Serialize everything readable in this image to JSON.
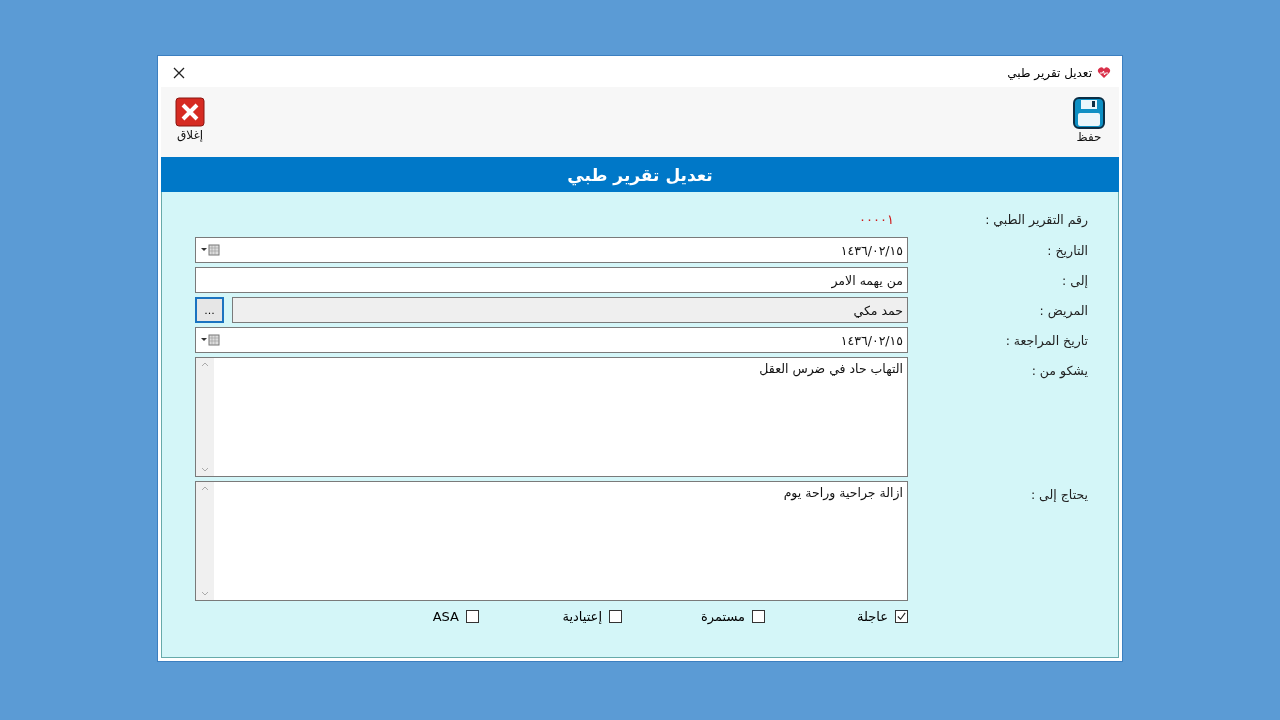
{
  "window": {
    "title": "تعديل تقرير طبي"
  },
  "toolbar": [
    {
      "kind": "save",
      "label": "حفظ"
    },
    {
      "kind": "close",
      "label": "إغلاق"
    }
  ],
  "banner": "تعديل تقرير طبي",
  "fields": [
    {
      "kind": "readout",
      "label": "رقم التقرير الطبي :",
      "value": "٠٠٠٠١"
    },
    {
      "kind": "date",
      "label": "التاريخ :",
      "value": "١٤٣٦/٠٢/١٥"
    },
    {
      "kind": "text",
      "label": "إلى :",
      "value": "من يهمه الامر"
    },
    {
      "kind": "lookup",
      "label": "المريض :",
      "value": "حمد مكي",
      "button": "..."
    },
    {
      "kind": "date",
      "label": "تاريخ المراجعة :",
      "value": "١٤٣٦/٠٢/١٥"
    },
    {
      "kind": "memo",
      "label": "يشكو من :",
      "value": "التهاب حاد في ضرس العقل"
    },
    {
      "kind": "memo",
      "label": "يحتاج إلى :",
      "value": "ازالة جراحية وراحة يوم"
    }
  ],
  "checkboxes": [
    {
      "label": "عاجلة",
      "checked": true
    },
    {
      "label": "مستمرة",
      "checked": false
    },
    {
      "label": "إعتيادية",
      "checked": false
    },
    {
      "label": "ASA",
      "checked": false
    }
  ]
}
